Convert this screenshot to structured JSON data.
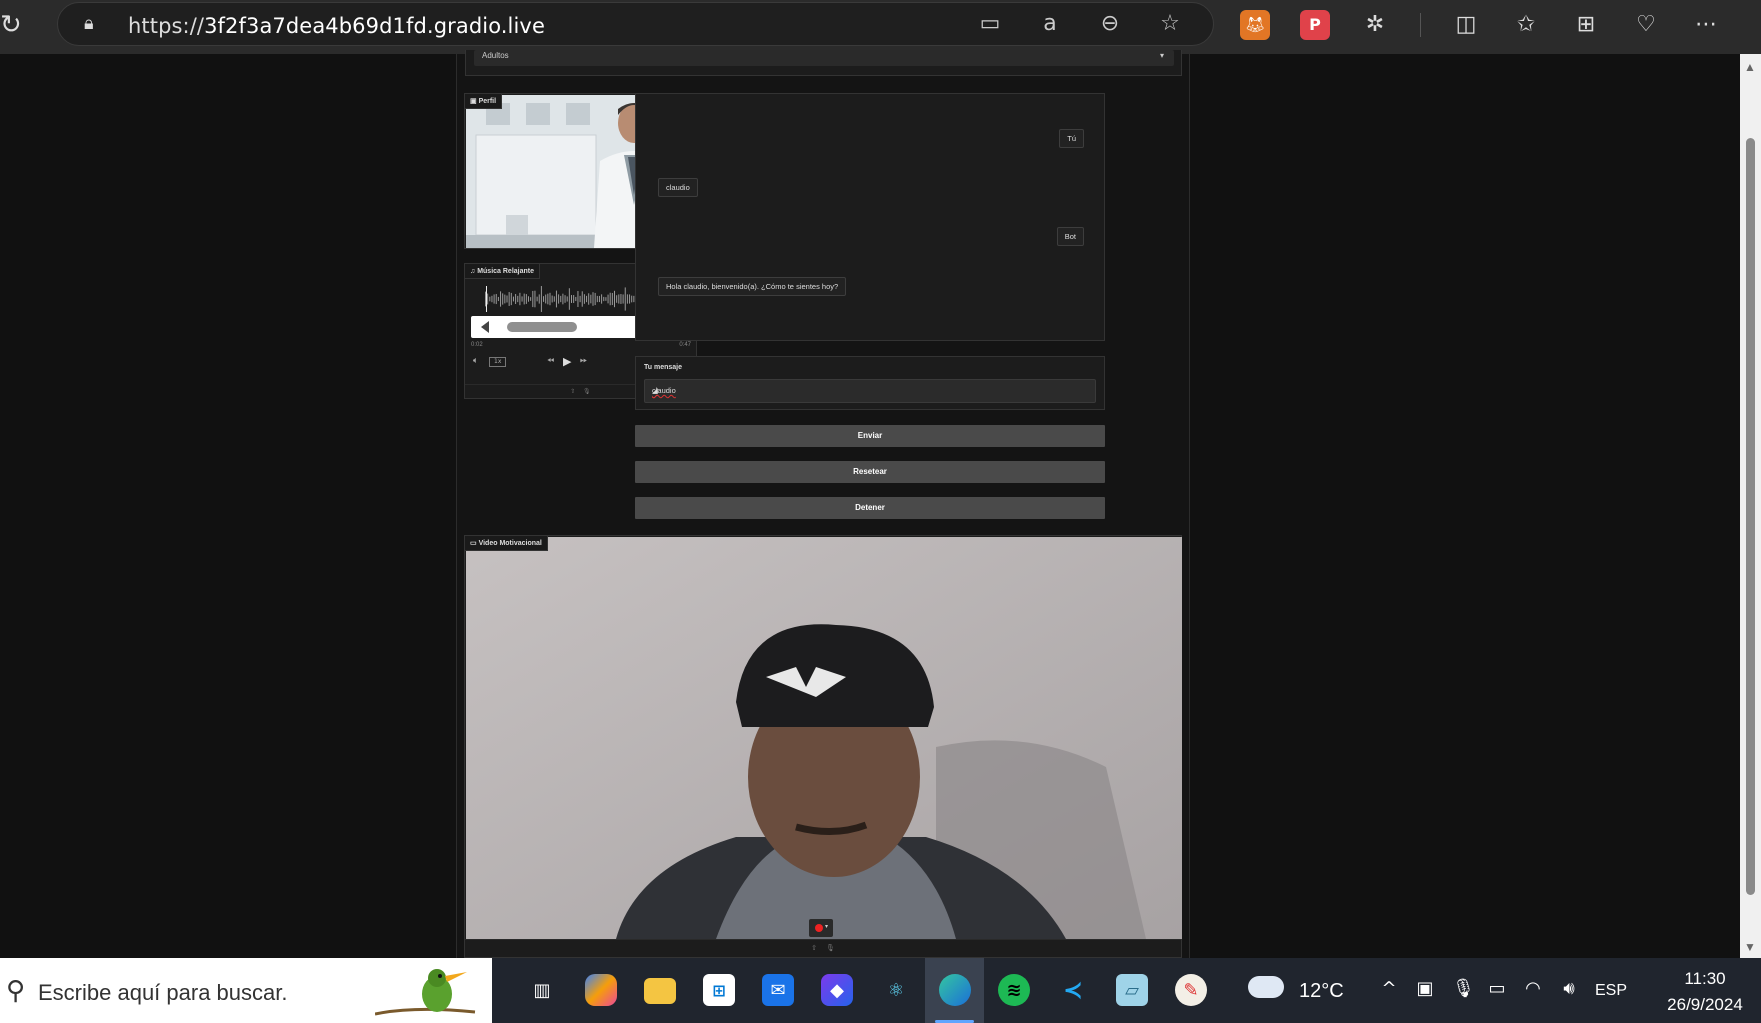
{
  "browser": {
    "url_prefix": "https://",
    "url_host": "3f2f3a7dea4b69d1fd.gradio.live"
  },
  "app": {
    "age_select": {
      "value": "Adultos"
    },
    "profile": {
      "label": "Perfil"
    },
    "music": {
      "label": "Música Relajante",
      "time_current": "0:02",
      "time_total": "0:47",
      "speed": "1x"
    },
    "chat": {
      "messages": [
        {
          "role_tag": "Tú",
          "text": "claudio"
        },
        {
          "role_tag": "Bot",
          "text": "Hola claudio, bienvenido(a). ¿Cómo te sientes hoy?"
        }
      ]
    },
    "message": {
      "label": "Tu mensaje",
      "value": "claudio"
    },
    "buttons": {
      "enviar": "Enviar",
      "resetear": "Resetear",
      "detener": "Detener"
    },
    "video": {
      "label": "Video Motivacional"
    }
  },
  "taskbar": {
    "search_placeholder": "Escribe aquí para buscar.",
    "weather": "12°C",
    "language": "ESP",
    "time": "11:30",
    "date": "26/9/2024"
  },
  "colors": {
    "page_bg": "#111111",
    "panel_bg": "#1c1c1c",
    "button_bg": "#4a4a4a",
    "taskbar_bg": "#20252e"
  }
}
